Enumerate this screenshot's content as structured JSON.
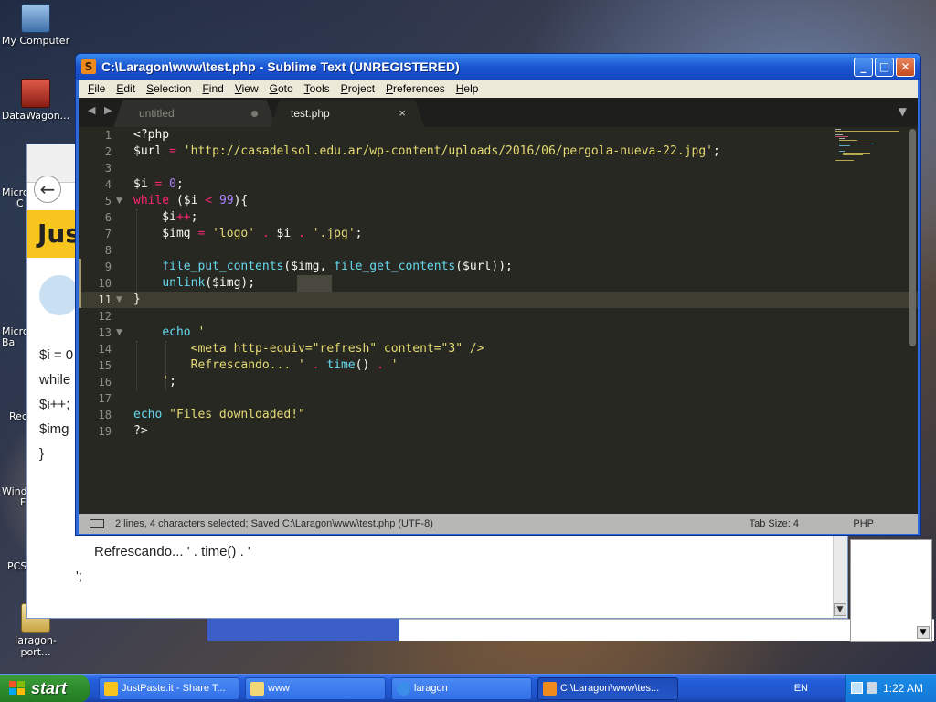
{
  "desktop": {
    "icons": [
      {
        "label": "My Computer"
      },
      {
        "label": "DataWagon..."
      },
      {
        "label": "laragon-port..."
      }
    ],
    "edge_labels": [
      "Micro",
      "C",
      "Micro",
      "Ba",
      "Rec",
      "Windo",
      "F",
      "PCS"
    ]
  },
  "background_browser": {
    "banner_text": "Jus",
    "back_icon": "arrow-left-icon",
    "code_lines": [
      "$i = 0",
      "while",
      "$i++;",
      "$img",
      "}"
    ],
    "bottom_lines": [
      "Refrescando... ' . time() . '",
      "';"
    ]
  },
  "sublime": {
    "title": "C:\\Laragon\\www\\test.php - Sublime Text (UNREGISTERED)",
    "icon_letter": "S",
    "menu": [
      {
        "label": "File",
        "ul": "F",
        "rest": "ile"
      },
      {
        "label": "Edit",
        "ul": "E",
        "rest": "dit"
      },
      {
        "label": "Selection",
        "ul": "S",
        "rest": "election"
      },
      {
        "label": "Find",
        "ul": "F",
        "rest": "ind"
      },
      {
        "label": "View",
        "ul": "V",
        "rest": "iew"
      },
      {
        "label": "Goto",
        "ul": "G",
        "rest": "oto"
      },
      {
        "label": "Tools",
        "ul": "T",
        "rest": "ools"
      },
      {
        "label": "Project",
        "ul": "P",
        "rest": "roject"
      },
      {
        "label": "Preferences",
        "ul": "P",
        "rest": "references"
      },
      {
        "label": "Help",
        "ul": "H",
        "rest": "elp"
      }
    ],
    "tabs": {
      "untitled": "untitled",
      "active": "test.php",
      "close_glyph": "×",
      "arrows": "◀ ▶",
      "dropdown": "▼"
    },
    "line_numbers": [
      "1",
      "2",
      "3",
      "4",
      "5",
      "6",
      "7",
      "8",
      "9",
      "10",
      "11",
      "12",
      "13",
      "14",
      "15",
      "16",
      "17",
      "18",
      "19"
    ],
    "current_line": 11,
    "status": {
      "message": "2 lines, 4 characters selected; Saved C:\\Laragon\\www\\test.php (UTF-8)",
      "tab_size": "Tab Size: 4",
      "syntax": "PHP"
    },
    "colors": {
      "bg": "#272822",
      "keyword": "#f92672",
      "string": "#e6db74",
      "function": "#66d9ef",
      "number": "#ae81ff"
    }
  },
  "taskbar": {
    "start_label": "start",
    "buttons": [
      {
        "label": "JustPaste.it - Share T..."
      },
      {
        "label": "www"
      },
      {
        "label": "laragon"
      },
      {
        "label": "C:\\Laragon\\www\\tes..."
      }
    ],
    "language": "EN",
    "clock": "1:22 AM"
  }
}
